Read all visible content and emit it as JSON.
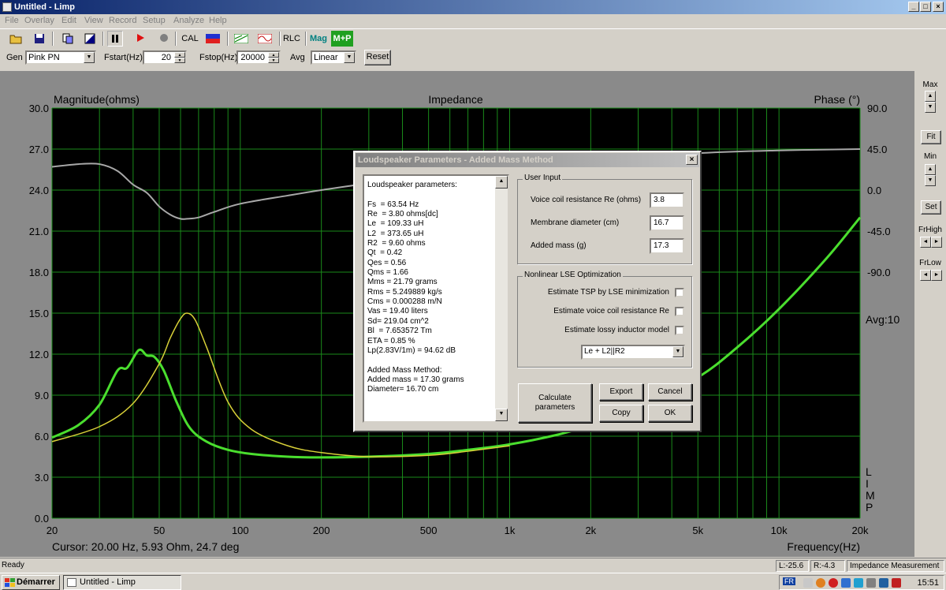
{
  "window": {
    "title": "Untitled - Limp",
    "min": "_",
    "max": "□",
    "close": "×"
  },
  "menu": [
    "File",
    "Overlay",
    "Edit",
    "View",
    "Record",
    "Setup",
    "Analyze",
    "Help"
  ],
  "toolbar": {
    "cal": "CAL",
    "rlc": "RLC",
    "mag": "Mag",
    "mp": "M+P"
  },
  "genrow": {
    "gen_label": "Gen",
    "gen_value": "Pink PN",
    "fstart_label": "Fstart(Hz)",
    "fstart_value": "20",
    "fstop_label": "Fstop(Hz)",
    "fstop_value": "20000",
    "avg_label": "Avg",
    "avg_value": "Linear",
    "reset": "Reset"
  },
  "chart_data": {
    "type": "line",
    "title": "Impedance",
    "ylabel_left": "Magnitude(ohms)",
    "ylabel_right": "Phase (°)",
    "xlabel": "Frequency(Hz)",
    "x_scale": "log",
    "xlim": [
      20,
      20000
    ],
    "ylim_left": [
      0,
      30
    ],
    "ylim_right": [
      -180,
      90
    ],
    "yticks_left": [
      "30.0",
      "27.0",
      "24.0",
      "21.0",
      "18.0",
      "15.0",
      "12.0",
      "9.0",
      "6.0",
      "3.0",
      "0.0"
    ],
    "yticks_right": [
      "90.0",
      "45.0",
      "0.0",
      "-45.0",
      "-90.0"
    ],
    "xticks": [
      {
        "v": 20,
        "t": "20"
      },
      {
        "v": 50,
        "t": "50"
      },
      {
        "v": 100,
        "t": "100"
      },
      {
        "v": 200,
        "t": "200"
      },
      {
        "v": 500,
        "t": "500"
      },
      {
        "v": 1000,
        "t": "1k"
      },
      {
        "v": 2000,
        "t": "2k"
      },
      {
        "v": 5000,
        "t": "5k"
      },
      {
        "v": 10000,
        "t": "10k"
      },
      {
        "v": 20000,
        "t": "20k"
      }
    ],
    "grid": true,
    "avg_label": "Avg:10",
    "side_letters": [
      "L",
      "I",
      "M",
      "P"
    ],
    "cursor_text": "Cursor: 20.00 Hz, 5.93 Ohm, 24.7 deg",
    "series": [
      {
        "color": "#4ade2e",
        "values_x": [
          20,
          25,
          30,
          35,
          38,
          42,
          45,
          48,
          52,
          58,
          65,
          75,
          90,
          110,
          150,
          200,
          300,
          500,
          700,
          1000,
          1500,
          2000,
          3000,
          5000,
          7000,
          10000,
          15000,
          20000
        ],
        "values_y": [
          5.9,
          6.8,
          8.3,
          10.8,
          11.0,
          12.3,
          11.9,
          11.8,
          10.8,
          8.5,
          6.6,
          5.6,
          5.0,
          4.7,
          4.5,
          4.45,
          4.5,
          4.7,
          5.0,
          5.4,
          6.1,
          6.8,
          8.0,
          10.3,
          12.5,
          15.3,
          19.0,
          22.0
        ]
      },
      {
        "color": "#d8d038",
        "values_x": [
          20,
          30,
          40,
          50,
          55,
          60,
          63.5,
          68,
          75,
          90,
          110,
          150,
          200,
          300,
          500,
          700,
          1000
        ],
        "values_y": [
          5.6,
          6.7,
          8.4,
          11.3,
          13.2,
          14.6,
          15.0,
          14.5,
          12.5,
          8.5,
          6.5,
          5.3,
          4.8,
          4.5,
          4.6,
          4.9,
          5.3
        ]
      },
      {
        "color": "#a8a8a8",
        "values_x": [
          20,
          25,
          30,
          35,
          40,
          45,
          50,
          55,
          60,
          63.5,
          70,
          80,
          100,
          150,
          200,
          300,
          500,
          1000,
          2000,
          5000,
          10000,
          20000
        ],
        "values_y": [
          25.7,
          25.9,
          25.9,
          25.4,
          24.4,
          23.8,
          22.8,
          22.2,
          21.9,
          21.9,
          22.0,
          22.4,
          23.0,
          23.6,
          24.0,
          24.5,
          25.0,
          25.6,
          26.2,
          26.7,
          26.9,
          27.0
        ]
      }
    ]
  },
  "rightpanel": {
    "max": "Max",
    "fit": "Fit",
    "min": "Min",
    "set": "Set",
    "frhigh": "FrHigh",
    "frlow": "FrLow"
  },
  "dialog": {
    "title": "Loudspeaker Parameters - Added Mass Method",
    "close": "×",
    "params_text": "Loudspeaker parameters:\n\nFs  = 63.54 Hz\nRe  = 3.80 ohms[dc]\nLe  = 109.33 uH\nL2  = 373.65 uH\nR2  = 9.60 ohms\nQt  = 0.42\nQes = 0.56\nQms = 1.66\nMms = 21.79 grams\nRms = 5.249889 kg/s\nCms = 0.000288 m/N\nVas = 19.40 liters\nSd= 219.04 cm^2\nBl  = 7.653572 Tm\nETA = 0.85 %\nLp(2.83V/1m) = 94.62 dB\n\nAdded Mass Method:\nAdded mass = 17.30 grams\nDiameter= 16.70 cm",
    "user_input": {
      "legend": "User Input",
      "re_label": "Voice coil resistance Re (ohms)",
      "re_value": "3.8",
      "diam_label": "Membrane diameter (cm)",
      "diam_value": "16.7",
      "mass_label": "Added mass (g)",
      "mass_value": "17.3"
    },
    "lse": {
      "legend": "Nonlinear LSE Optimization",
      "opt1": "Estimate TSP by LSE minimization",
      "opt2": "Estimate voice coil resistance Re",
      "opt3": "Estimate lossy inductor model",
      "model_value": "Le + L2||R2"
    },
    "buttons": {
      "calc": "Calculate\nparameters",
      "export": "Export",
      "cancel": "Cancel",
      "copy": "Copy",
      "ok": "OK"
    }
  },
  "status": {
    "ready": "Ready",
    "left": "L:-25.6",
    "right": "R:-4.3",
    "mode": "Impedance Measurement"
  },
  "taskbar": {
    "start": "Démarrer",
    "task": "Untitled - Limp",
    "lang": "FR",
    "clock": "15:51"
  }
}
